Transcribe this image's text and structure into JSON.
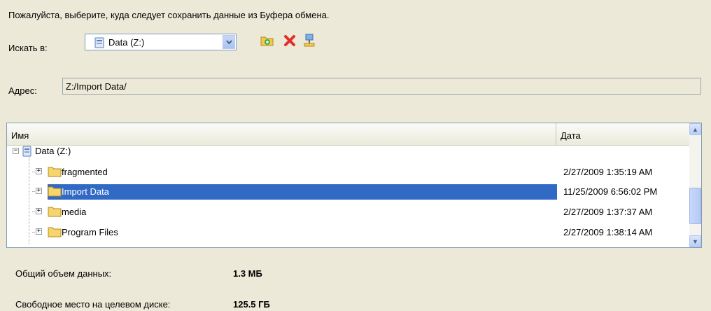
{
  "instruction": "Пожалуйста, выберите, куда следует сохранить данные из Буфера обмена.",
  "lookin": {
    "label": "Искать в:",
    "value": "Data (Z:)",
    "icon": "drive-icon"
  },
  "toolbar": {
    "buttons": [
      {
        "name": "new-folder-icon"
      },
      {
        "name": "delete-icon"
      },
      {
        "name": "network-icon"
      }
    ]
  },
  "address": {
    "label": "Адрес:",
    "value": "Z:/Import Data/"
  },
  "list": {
    "columns": [
      "Имя",
      "Дата"
    ],
    "root": {
      "label": "Data (Z:)",
      "expander": "−"
    },
    "rows": [
      {
        "name": "fragmented",
        "date": "2/27/2009 1:35:19 AM",
        "selected": false,
        "expander": "+"
      },
      {
        "name": "Import Data",
        "date": "11/25/2009 6:56:02 PM",
        "selected": true,
        "expander": "+"
      },
      {
        "name": "media",
        "date": "2/27/2009 1:37:37 AM",
        "selected": false,
        "expander": "+"
      },
      {
        "name": "Program Files",
        "date": "2/27/2009 1:38:14 AM",
        "selected": false,
        "expander": "+"
      }
    ]
  },
  "summary": {
    "total_label": "Общий объем данных:",
    "total_value": "1.3 МБ",
    "free_label": "Свободное место на целевом диске:",
    "free_value": "125.5 ГБ"
  },
  "colors": {
    "background": "#ece9d8",
    "selection": "#316ac5",
    "border": "#7f9db9",
    "folder": "#f5d56c"
  }
}
